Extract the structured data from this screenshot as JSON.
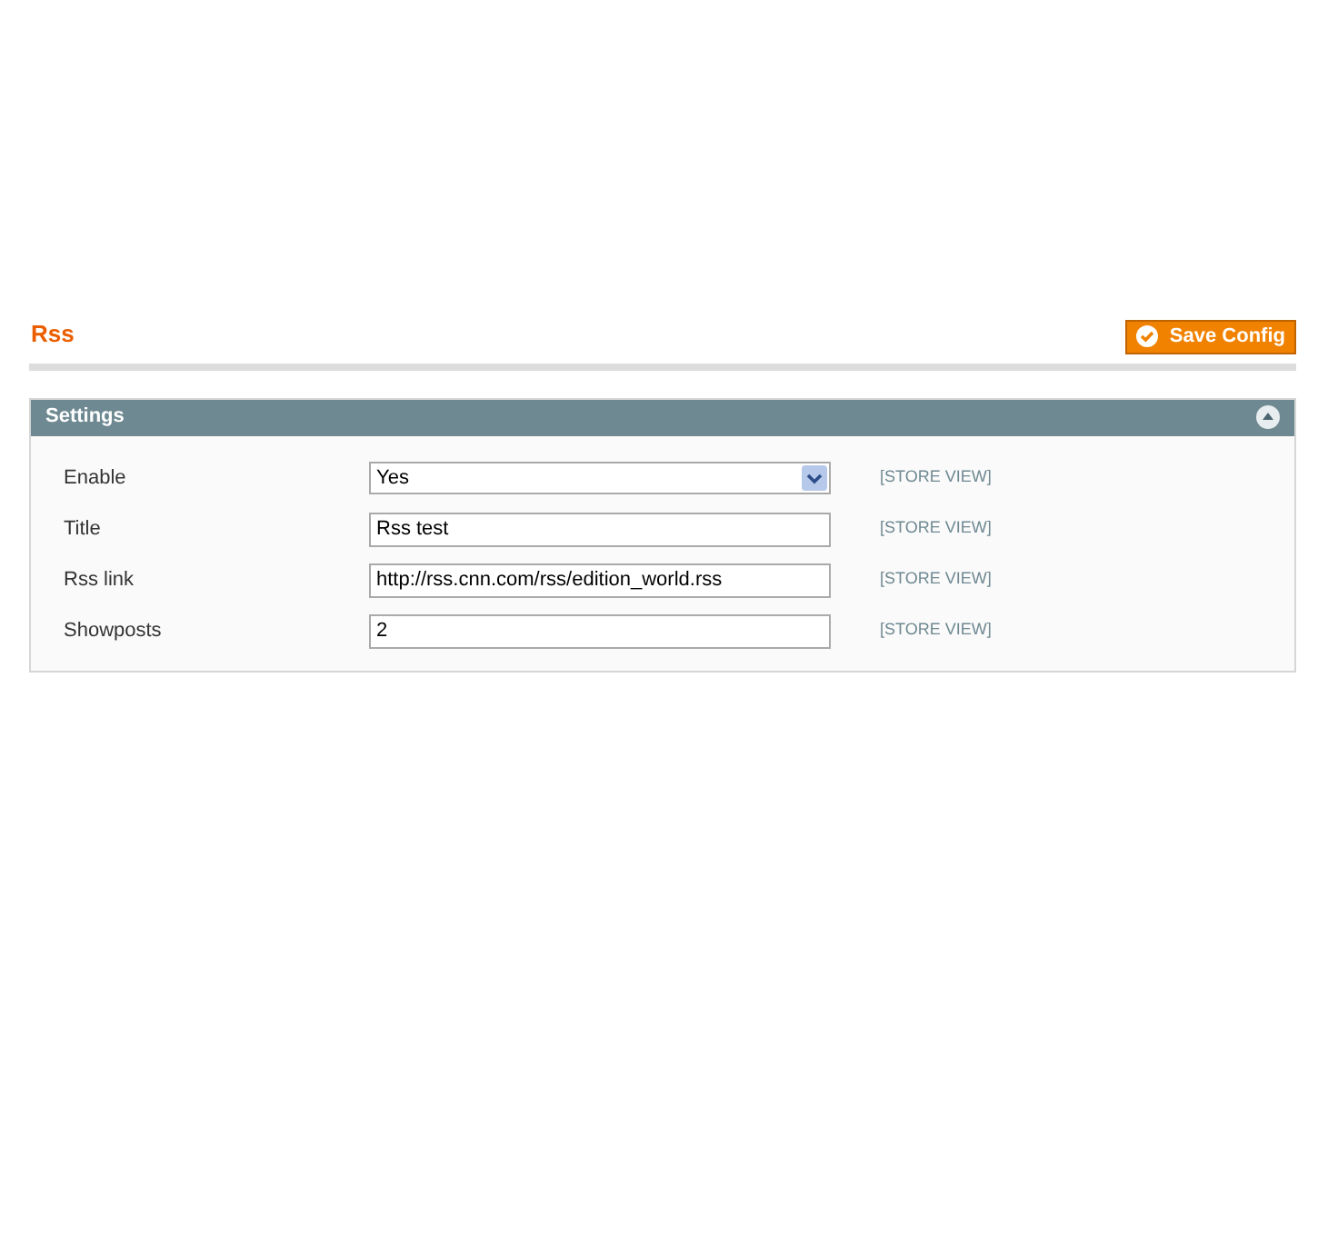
{
  "page_title": "Rss",
  "save_button": "Save Config",
  "section": {
    "title": "Settings",
    "expanded": true,
    "fields": [
      {
        "label": "Enable",
        "kind": "select",
        "value": "Yes",
        "scope": "[STORE VIEW]"
      },
      {
        "label": "Title",
        "kind": "text",
        "value": "Rss test",
        "scope": "[STORE VIEW]"
      },
      {
        "label": "Rss link",
        "kind": "text",
        "value": "http://rss.cnn.com/rss/edition_world.rss",
        "scope": "[STORE VIEW]"
      },
      {
        "label": "Showposts",
        "kind": "text",
        "value": "2",
        "scope": "[STORE VIEW]"
      }
    ]
  }
}
